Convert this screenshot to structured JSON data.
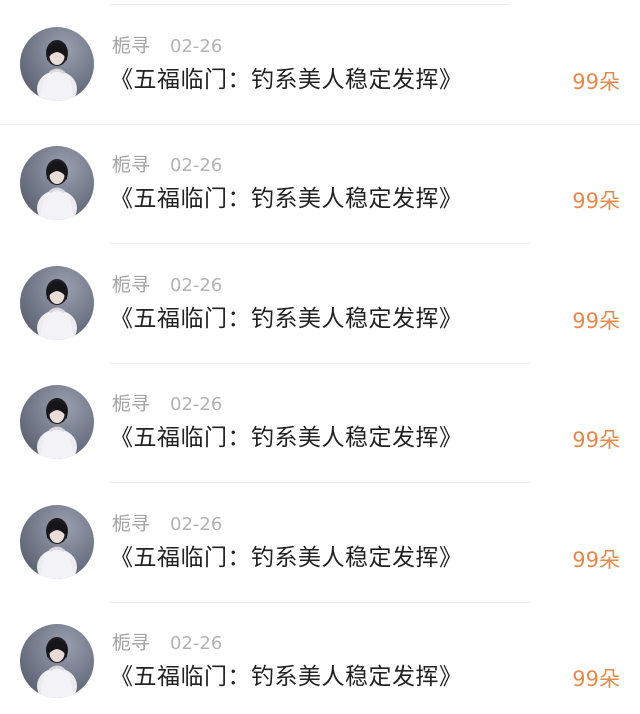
{
  "comments": [
    {
      "name": "栀寻",
      "date": "02-26",
      "title": "《五福临门：钓系美人稳定发挥》",
      "count": "99朵"
    },
    {
      "name": "栀寻",
      "date": "02-26",
      "title": "《五福临门：钓系美人稳定发挥》",
      "count": "99朵"
    },
    {
      "name": "栀寻",
      "date": "02-26",
      "title": "《五福临门：钓系美人稳定发挥》",
      "count": "99朵"
    },
    {
      "name": "栀寻",
      "date": "02-26",
      "title": "《五福临门：钓系美人稳定发挥》",
      "count": "99朵"
    },
    {
      "name": "栀寻",
      "date": "02-26",
      "title": "《五福临门：钓系美人稳定发挥》",
      "count": "99朵"
    },
    {
      "name": "栀寻",
      "date": "02-26",
      "title": "《五福临门：钓系美人稳定发挥》",
      "count": "99朵"
    }
  ],
  "colors": {
    "count": "#e8894a",
    "name": "#a3a3a3",
    "title": "#222222"
  }
}
